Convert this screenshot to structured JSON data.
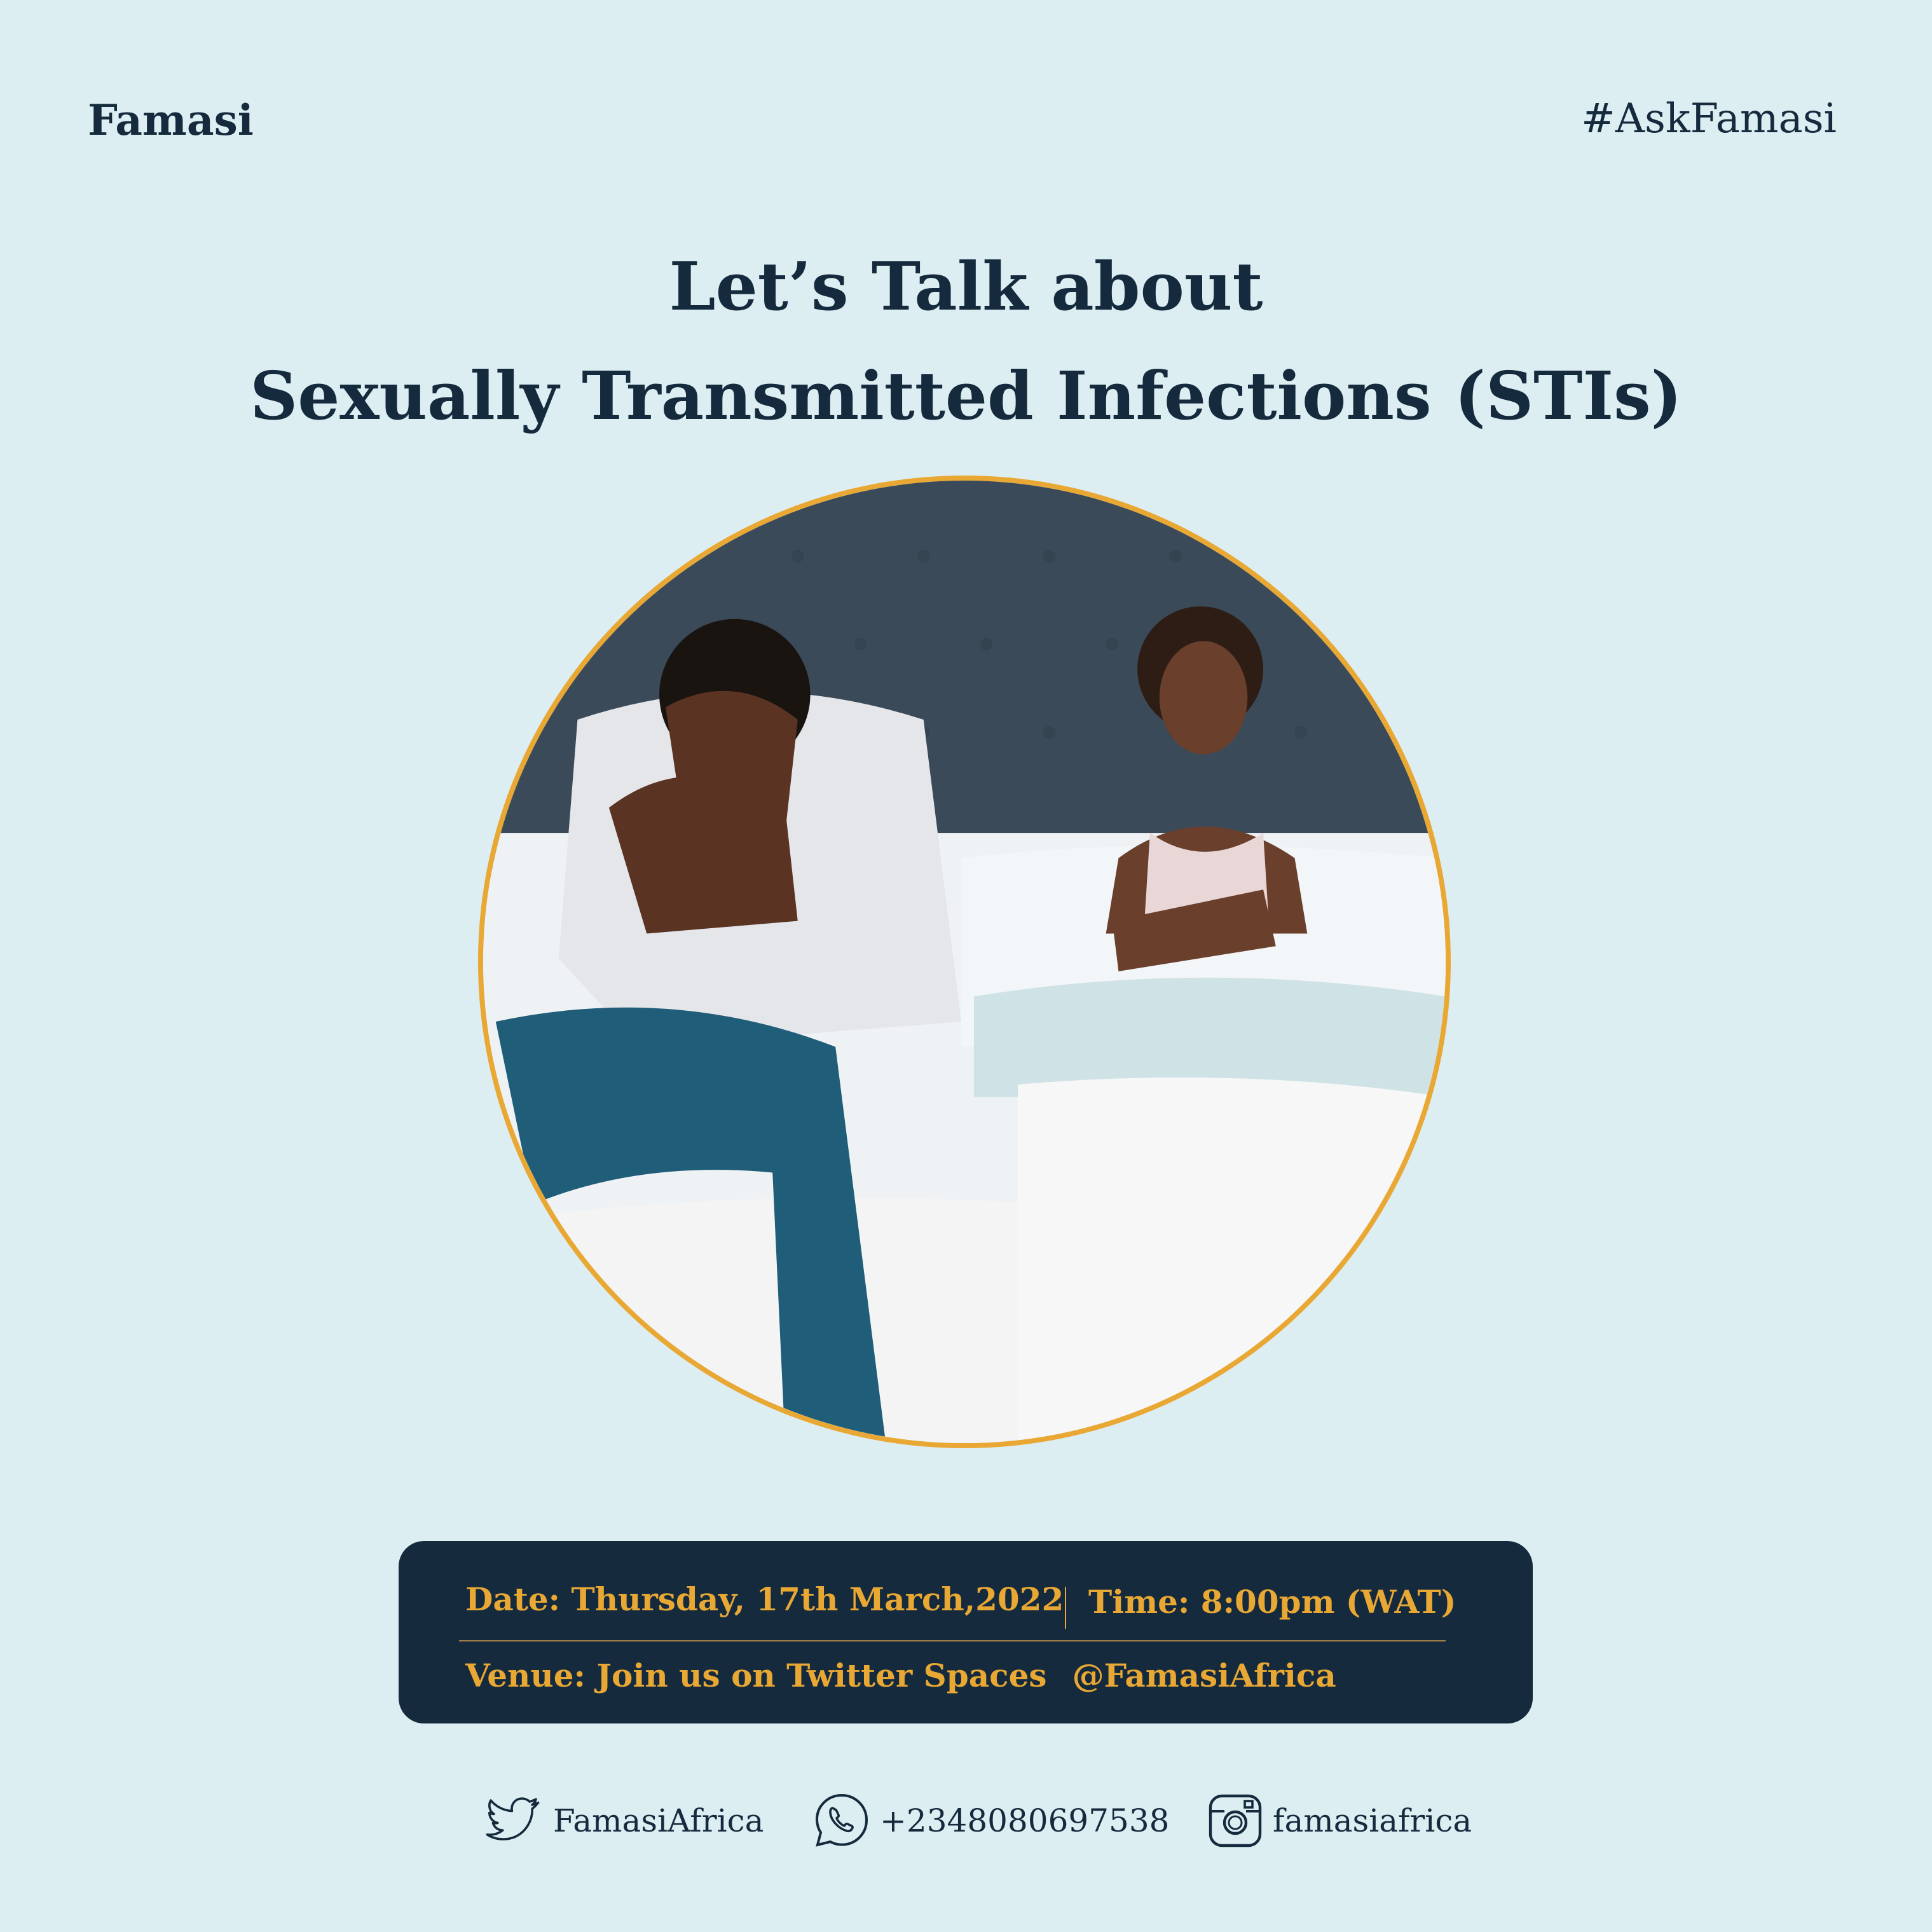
{
  "header": {
    "brand": "Famasi",
    "hashtag": "#AskFamasi"
  },
  "title": {
    "line1": "Let’s Talk about",
    "line2": "Sexually Transmitted Infections (STIs)"
  },
  "photo": {
    "description_icon": "couple-photo"
  },
  "event": {
    "date": "Date: Thursday, 17th March,2022",
    "time": "Time: 8:00pm (WAT)",
    "venue": "Venue: Join us on Twitter Spaces",
    "handle": "@FamasiAfrica"
  },
  "contacts": {
    "twitter": "FamasiAfrica",
    "whatsapp": "+2348080697538",
    "instagram": "famasiafrica"
  },
  "colors": {
    "background": "#ddeef3",
    "navy": "#152b3d",
    "accent": "#e9a834"
  }
}
